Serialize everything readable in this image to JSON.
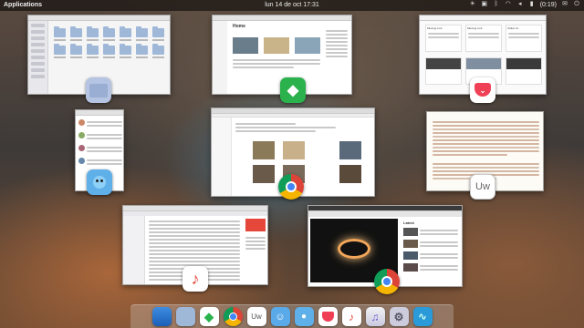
{
  "panel": {
    "applications_label": "Applications",
    "datetime": "lun 14 de oct 17:31",
    "battery_text": "(0:19)"
  },
  "windows": {
    "files": {
      "folder_count": 14
    },
    "feedly": {
      "title": "Home"
    },
    "pocket": {
      "cards": [
        "Missing Link",
        "Missing Link",
        "Oldies Sr",
        "",
        "",
        ""
      ]
    },
    "chrome_left": {},
    "article": {
      "paragraph_lines": 20
    },
    "music": {
      "rows": 17
    },
    "video": {
      "channel": "Latest"
    }
  },
  "colors": {
    "feedly": "#2bb24c",
    "pocket": "#ef4056",
    "chrome_red": "#db4437",
    "chrome_yellow": "#f4b400",
    "chrome_green": "#0f9d58",
    "chrome_blue": "#4285f4",
    "twitter_bird": "#5fb0e8",
    "music_red": "#e5473b"
  },
  "dock": {
    "items": [
      "files-manager-icon",
      "folder-icon",
      "feedly-icon",
      "chrome-icon",
      "uw-icon",
      "finder-face-icon",
      "twitter-bird-icon",
      "pocket-icon",
      "music-icon",
      "itunes-icon",
      "settings-icon",
      "activity-monitor-icon"
    ]
  },
  "badges": {
    "uw_text": "Uw",
    "dock_uw_text": "Uw"
  }
}
